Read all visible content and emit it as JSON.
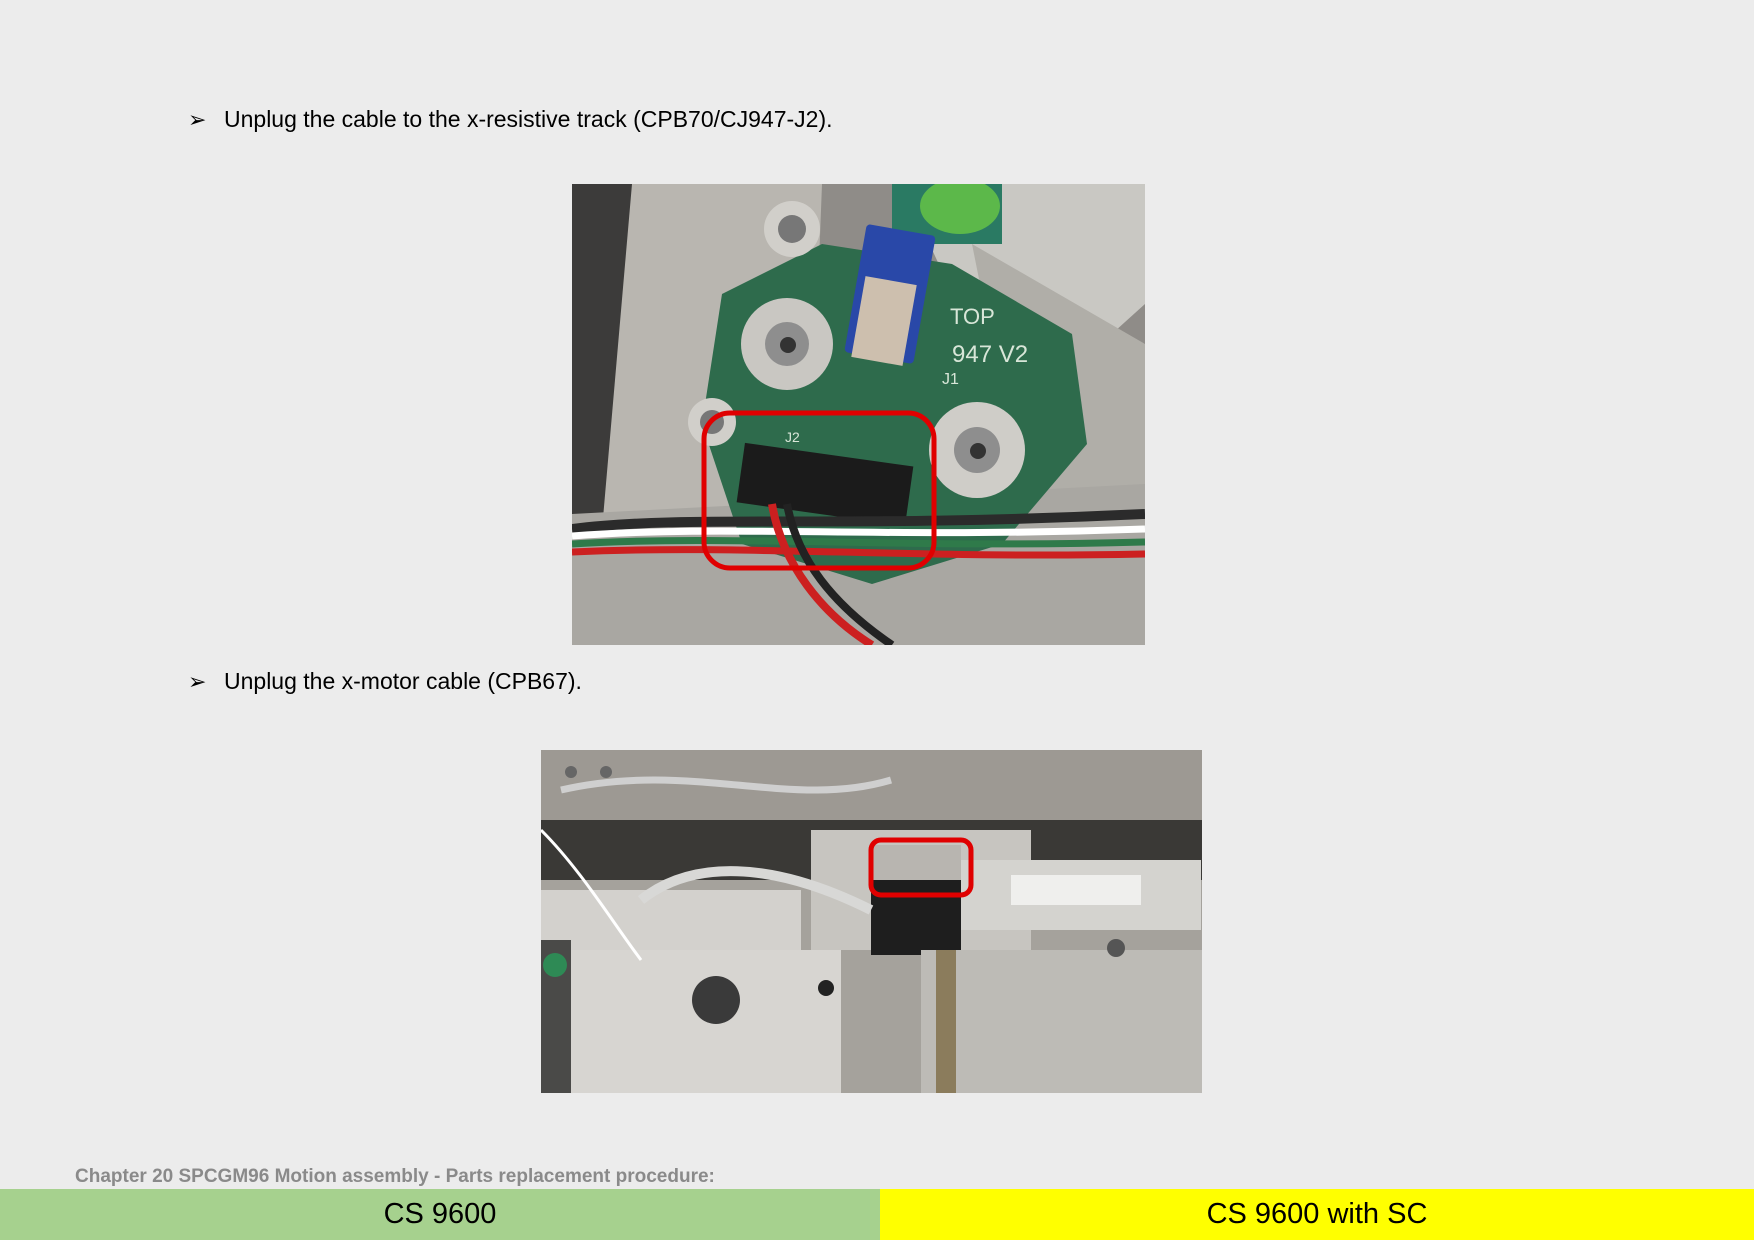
{
  "steps": [
    {
      "text": "Unplug the cable to the x-resistive track (CPB70/CJ947-J2)."
    },
    {
      "text": "Unplug the x-motor cable (CPB67)."
    }
  ],
  "bullet_icon": "arrowhead-bullet",
  "photos": [
    {
      "pcb_silkscreen": [
        "TOP",
        "947 V2",
        "J1",
        "J2"
      ]
    },
    {}
  ],
  "highlight_color": "#e00000",
  "footer": {
    "chapter": "Chapter 20 SPCGM96 Motion assembly - Parts replacement procedure:",
    "left_label": "CS 9600",
    "right_label": "CS 9600 with SC",
    "left_color": "#a6d18e",
    "right_color": "#ffff00"
  }
}
